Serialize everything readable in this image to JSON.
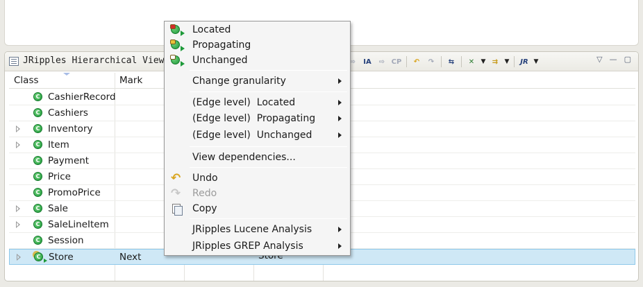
{
  "view": {
    "title": "JRipples Hierarchical View",
    "toolbar": [
      "⇨",
      "IA",
      "⇨",
      "CP",
      "↶",
      "↷",
      "⇆",
      "✕",
      "⇉",
      "JR"
    ],
    "controls": [
      "▽",
      "—",
      "▢"
    ]
  },
  "table": {
    "headers": {
      "class": "Class",
      "mark": "Mark"
    },
    "rows": [
      {
        "class": "CashierRecord",
        "expandable": false,
        "mark": "",
        "third": ""
      },
      {
        "class": "Cashiers",
        "expandable": false,
        "mark": "",
        "third": ""
      },
      {
        "class": "Inventory",
        "expandable": true,
        "mark": "",
        "third": ""
      },
      {
        "class": "Item",
        "expandable": true,
        "mark": "",
        "third": ""
      },
      {
        "class": "Payment",
        "expandable": false,
        "mark": "",
        "third": ""
      },
      {
        "class": "Price",
        "expandable": false,
        "mark": "",
        "third": ""
      },
      {
        "class": "PromoPrice",
        "expandable": false,
        "mark": "",
        "third": ""
      },
      {
        "class": "Sale",
        "expandable": true,
        "mark": "",
        "third": ""
      },
      {
        "class": "SaleLineItem",
        "expandable": true,
        "mark": "",
        "third": ""
      },
      {
        "class": "Session",
        "expandable": false,
        "mark": "",
        "third": ""
      },
      {
        "class": "Store",
        "expandable": true,
        "mark": "Next",
        "third": "Store",
        "selected": true
      }
    ],
    "icon_glyph": "C"
  },
  "context_menu": {
    "items": [
      {
        "label": "Located",
        "icon": "located-icon",
        "badge_color": "#d42b2b"
      },
      {
        "label": "Propagating",
        "icon": "propagating-icon",
        "badge_color": "#e8c23a"
      },
      {
        "label": "Unchanged",
        "icon": "unchanged-icon",
        "badge_color": "#ffffff"
      },
      {
        "label": "Change granularity",
        "submenu": true
      },
      {
        "label": "(Edge level)  Located",
        "submenu": true
      },
      {
        "label": "(Edge level)  Propagating",
        "submenu": true
      },
      {
        "label": "(Edge level)  Unchanged",
        "submenu": true
      },
      {
        "label": "View dependencies..."
      },
      {
        "label": "Undo",
        "icon": "undo-icon"
      },
      {
        "label": "Redo",
        "icon": "redo-icon",
        "disabled": true
      },
      {
        "label": "Copy",
        "icon": "copy-icon"
      },
      {
        "label": "JRipples Lucene Analysis",
        "submenu": true
      },
      {
        "label": "JRipples GREP Analysis",
        "submenu": true
      }
    ]
  },
  "colors": {
    "selection_bg": "#cfe8f6",
    "class_icon": "#1e9a3a",
    "menu_bg": "#f5f5f5"
  }
}
